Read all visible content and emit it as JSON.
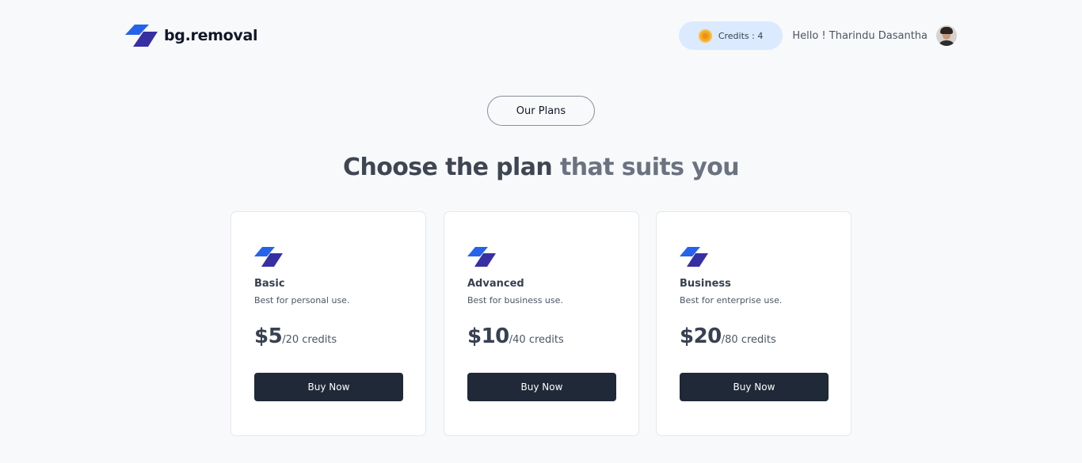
{
  "header": {
    "logo_text": "bg.removal",
    "credits_label": "Credits : 4",
    "greeting": "Hello ! Tharindu Dasantha"
  },
  "plans_badge": "Our Plans",
  "headline": {
    "part1": "Choose the plan ",
    "part2": "that suits you"
  },
  "plans": [
    {
      "name": "Basic",
      "description": "Best for personal use.",
      "price": "$5",
      "unit": "/20 credits",
      "button": "Buy Now"
    },
    {
      "name": "Advanced",
      "description": "Best for business use.",
      "price": "$10",
      "unit": "/40 credits",
      "button": "Buy Now"
    },
    {
      "name": "Business",
      "description": "Best for enterprise use.",
      "price": "$20",
      "unit": "/80 credits",
      "button": "Buy Now"
    }
  ],
  "colors": {
    "logo_top": "#2563eb",
    "logo_bottom": "#3730a3",
    "credits_bg": "#dbeafe",
    "button_bg": "#1f2937",
    "page_bg": "#f8f9fb"
  },
  "icons": {
    "logo": "logo-icon",
    "coin": "coin-icon",
    "avatar": "avatar"
  }
}
